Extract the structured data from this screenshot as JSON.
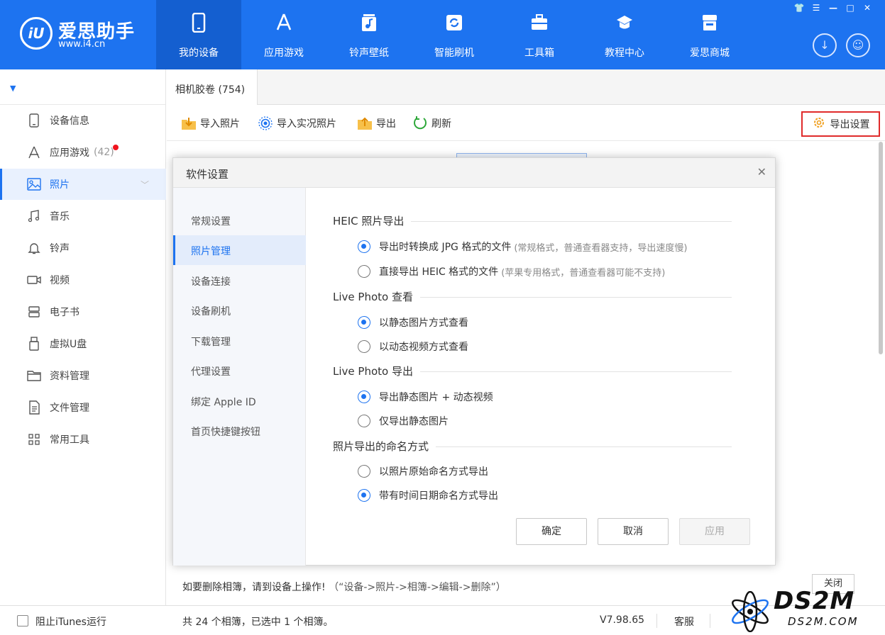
{
  "app": {
    "name": "爱思助手",
    "url": "www.i4.cn",
    "logo_mark": "iU"
  },
  "nav": [
    {
      "label": "我的设备",
      "icon": "phone-icon",
      "active": true
    },
    {
      "label": "应用游戏",
      "icon": "app-store-icon"
    },
    {
      "label": "铃声壁纸",
      "icon": "music-wallpaper-icon"
    },
    {
      "label": "智能刷机",
      "icon": "flash-icon"
    },
    {
      "label": "工具箱",
      "icon": "toolbox-icon"
    },
    {
      "label": "教程中心",
      "icon": "graduation-cap-icon"
    },
    {
      "label": "爱思商城",
      "icon": "store-icon"
    }
  ],
  "window_controls": [
    "shirt-icon",
    "menu-icon",
    "minimize-icon",
    "maximize-icon",
    "close-icon"
  ],
  "sidebar": {
    "device_selector": "▼",
    "items": [
      {
        "label": "设备信息",
        "icon": "device-info-icon"
      },
      {
        "label": "应用游戏",
        "count": "(42)",
        "icon": "app-store-icon",
        "badge": true
      },
      {
        "label": "照片",
        "icon": "photo-icon",
        "active": true
      },
      {
        "label": "音乐",
        "icon": "music-icon"
      },
      {
        "label": "铃声",
        "icon": "bell-icon"
      },
      {
        "label": "视频",
        "icon": "video-icon"
      },
      {
        "label": "电子书",
        "icon": "book-icon"
      },
      {
        "label": "虚拟U盘",
        "icon": "usb-icon"
      },
      {
        "label": "资料管理",
        "icon": "folder-icon"
      },
      {
        "label": "文件管理",
        "icon": "file-icon"
      },
      {
        "label": "常用工具",
        "icon": "grid-icon"
      }
    ]
  },
  "tab": {
    "label": "相机胶卷 (754)"
  },
  "toolbar": {
    "import_photos": "导入照片",
    "import_live": "导入实况照片",
    "export": "导出",
    "refresh": "刷新",
    "export_settings": "导出设置"
  },
  "dialog": {
    "title": "软件设置",
    "nav": [
      "常规设置",
      "照片管理",
      "设备连接",
      "设备刷机",
      "下载管理",
      "代理设置",
      "绑定 Apple ID",
      "首页快捷键按钮"
    ],
    "active_nav": 1,
    "sections": [
      {
        "title": "HEIC 照片导出",
        "options": [
          {
            "label": "导出时转换成 JPG 格式的文件",
            "note": "(常规格式，普通查看器支持，导出速度慢)",
            "checked": true
          },
          {
            "label": "直接导出 HEIC 格式的文件",
            "note": "(苹果专用格式，普通查看器可能不支持)",
            "checked": false
          }
        ]
      },
      {
        "title": "Live Photo 查看",
        "options": [
          {
            "label": "以静态图片方式查看",
            "checked": true
          },
          {
            "label": "以动态视频方式查看",
            "checked": false
          }
        ]
      },
      {
        "title": "Live Photo 导出",
        "options": [
          {
            "label": "导出静态图片 + 动态视频",
            "checked": true
          },
          {
            "label": "仅导出静态图片",
            "checked": false
          }
        ]
      },
      {
        "title": "照片导出的命名方式",
        "options": [
          {
            "label": "以照片原始命名方式导出",
            "checked": false
          },
          {
            "label": "带有时间日期命名方式导出",
            "checked": true
          }
        ]
      }
    ],
    "buttons": {
      "ok": "确定",
      "cancel": "取消",
      "apply": "应用"
    }
  },
  "bottom": {
    "message": "如要删除相簿，请到设备上操作!",
    "hint": "（“设备->照片->相簿->编辑->删除”）",
    "close": "关闭"
  },
  "status": {
    "block_itunes": "阻止iTunes运行",
    "summary": "共 24 个相簿，已选中 1 个相簿。",
    "version": "V7.98.65",
    "service": "客服"
  },
  "watermark": {
    "brand": "DS2M",
    "domain": "DS2M.COM"
  },
  "colors": {
    "primary": "#1d73f0",
    "highlight_border": "#e02b2b",
    "badge": "#f0141e"
  }
}
